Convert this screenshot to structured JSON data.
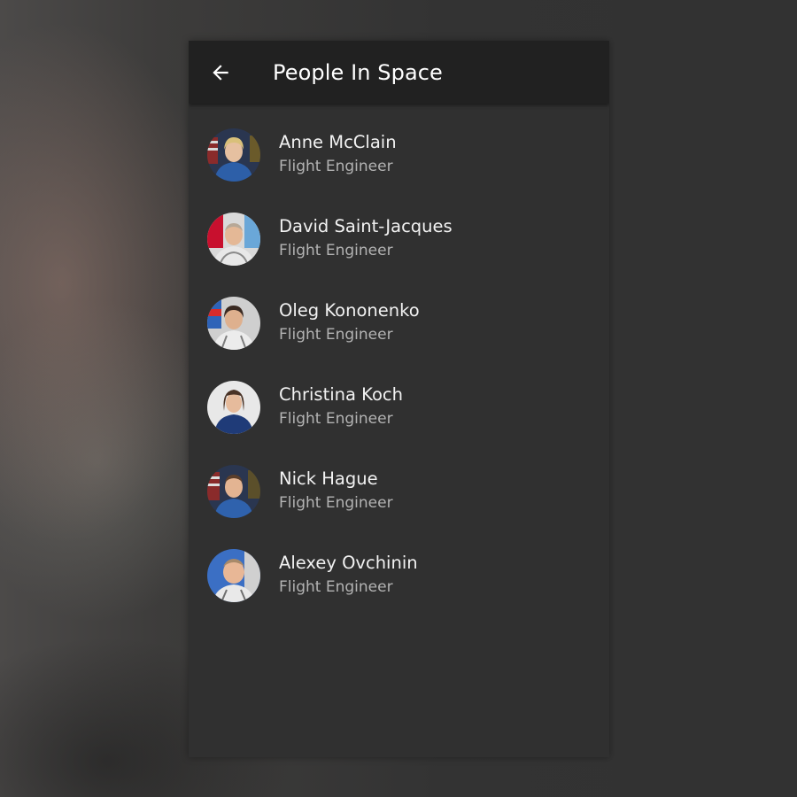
{
  "app_bar": {
    "back_icon": "arrow-back-icon",
    "title": "People In Space"
  },
  "people": [
    {
      "name": "Anne McClain",
      "role": "Flight Engineer"
    },
    {
      "name": "David Saint-Jacques",
      "role": "Flight Engineer"
    },
    {
      "name": "Oleg Kononenko",
      "role": "Flight Engineer"
    },
    {
      "name": "Christina Koch",
      "role": "Flight Engineer"
    },
    {
      "name": "Nick Hague",
      "role": "Flight Engineer"
    },
    {
      "name": "Alexey Ovchinin",
      "role": "Flight Engineer"
    }
  ],
  "colors": {
    "app_bar_bg": "#212121",
    "surface_bg": "#303030",
    "primary_text": "#f2f2f2",
    "secondary_text": "#b3b3b3"
  }
}
